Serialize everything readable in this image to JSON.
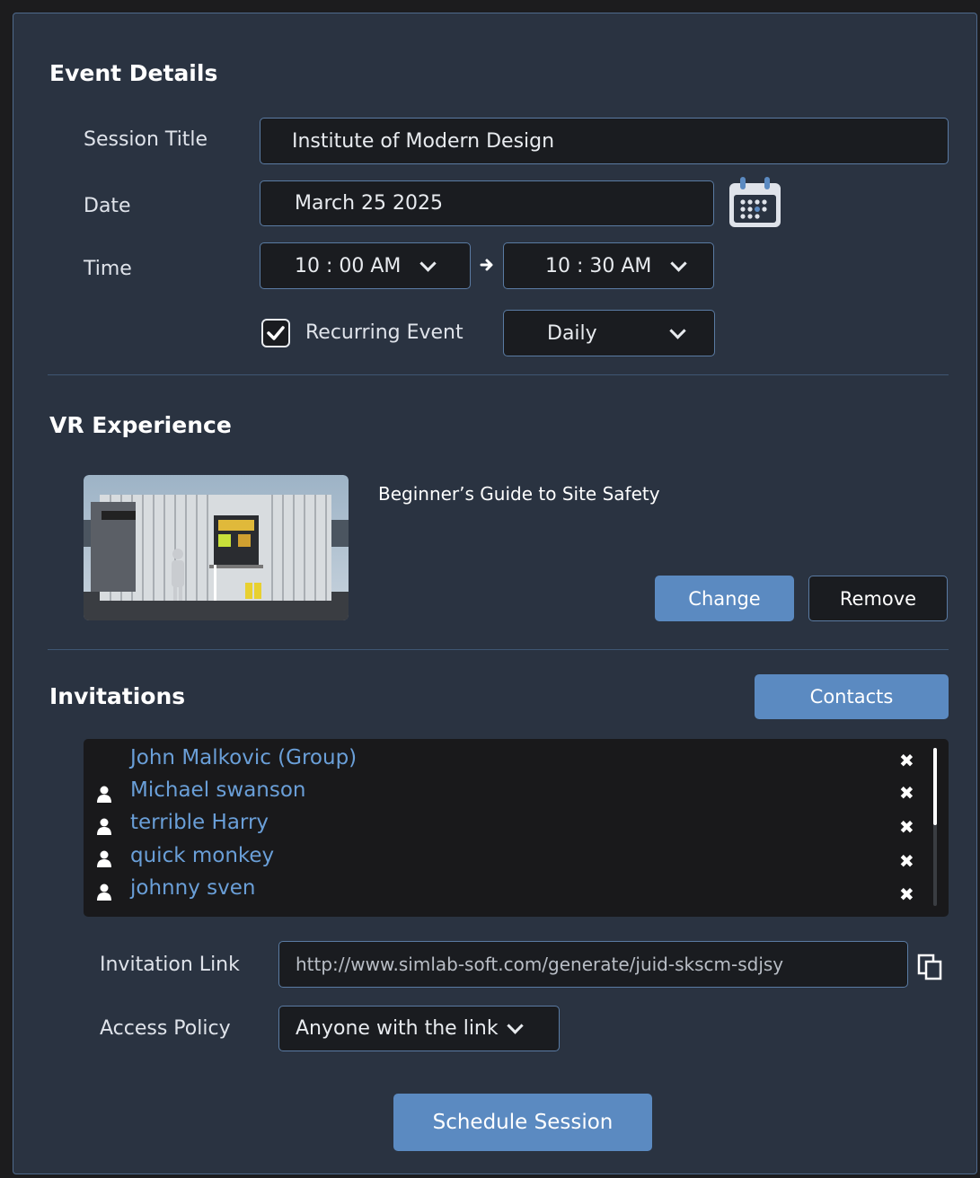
{
  "event_details": {
    "heading": "Event Details",
    "session_title_label": "Session Title",
    "session_title_value": "Institute of Modern Design",
    "date_label": "Date",
    "date_value": "March 25 2025",
    "time_label": "Time",
    "start_time": "10 : 00 AM",
    "end_time": "10 : 30 AM",
    "recurring_checked": true,
    "recurring_label": "Recurring Event",
    "recurrence_value": "Daily"
  },
  "vr_experience": {
    "heading": "VR Experience",
    "title": "Beginner’s Guide to Site Safety",
    "change_label": "Change",
    "remove_label": "Remove"
  },
  "invitations": {
    "heading": "Invitations",
    "contacts_label": "Contacts",
    "list": [
      {
        "name": "John Malkovic (Group)",
        "icon": "none"
      },
      {
        "name": "Michael swanson",
        "icon": "person-icon"
      },
      {
        "name": "terrible Harry",
        "icon": "person-icon"
      },
      {
        "name": "quick monkey",
        "icon": "person-icon"
      },
      {
        "name": "johnny sven",
        "icon": "person-icon"
      }
    ],
    "remove_glyph": "✖",
    "invitation_link_label": "Invitation Link",
    "invitation_link_value": "http://www.simlab-soft.com/generate/juid-skscm-sdjsy",
    "access_policy_label": "Access Policy",
    "access_policy_value": "Anyone with the link"
  },
  "schedule_label": "Schedule Session",
  "colors": {
    "panel": "#2a3341",
    "field": "#1a1c20",
    "border": "#5a7ba3",
    "accent": "#5b8ac1",
    "link": "#6a9fd8"
  }
}
